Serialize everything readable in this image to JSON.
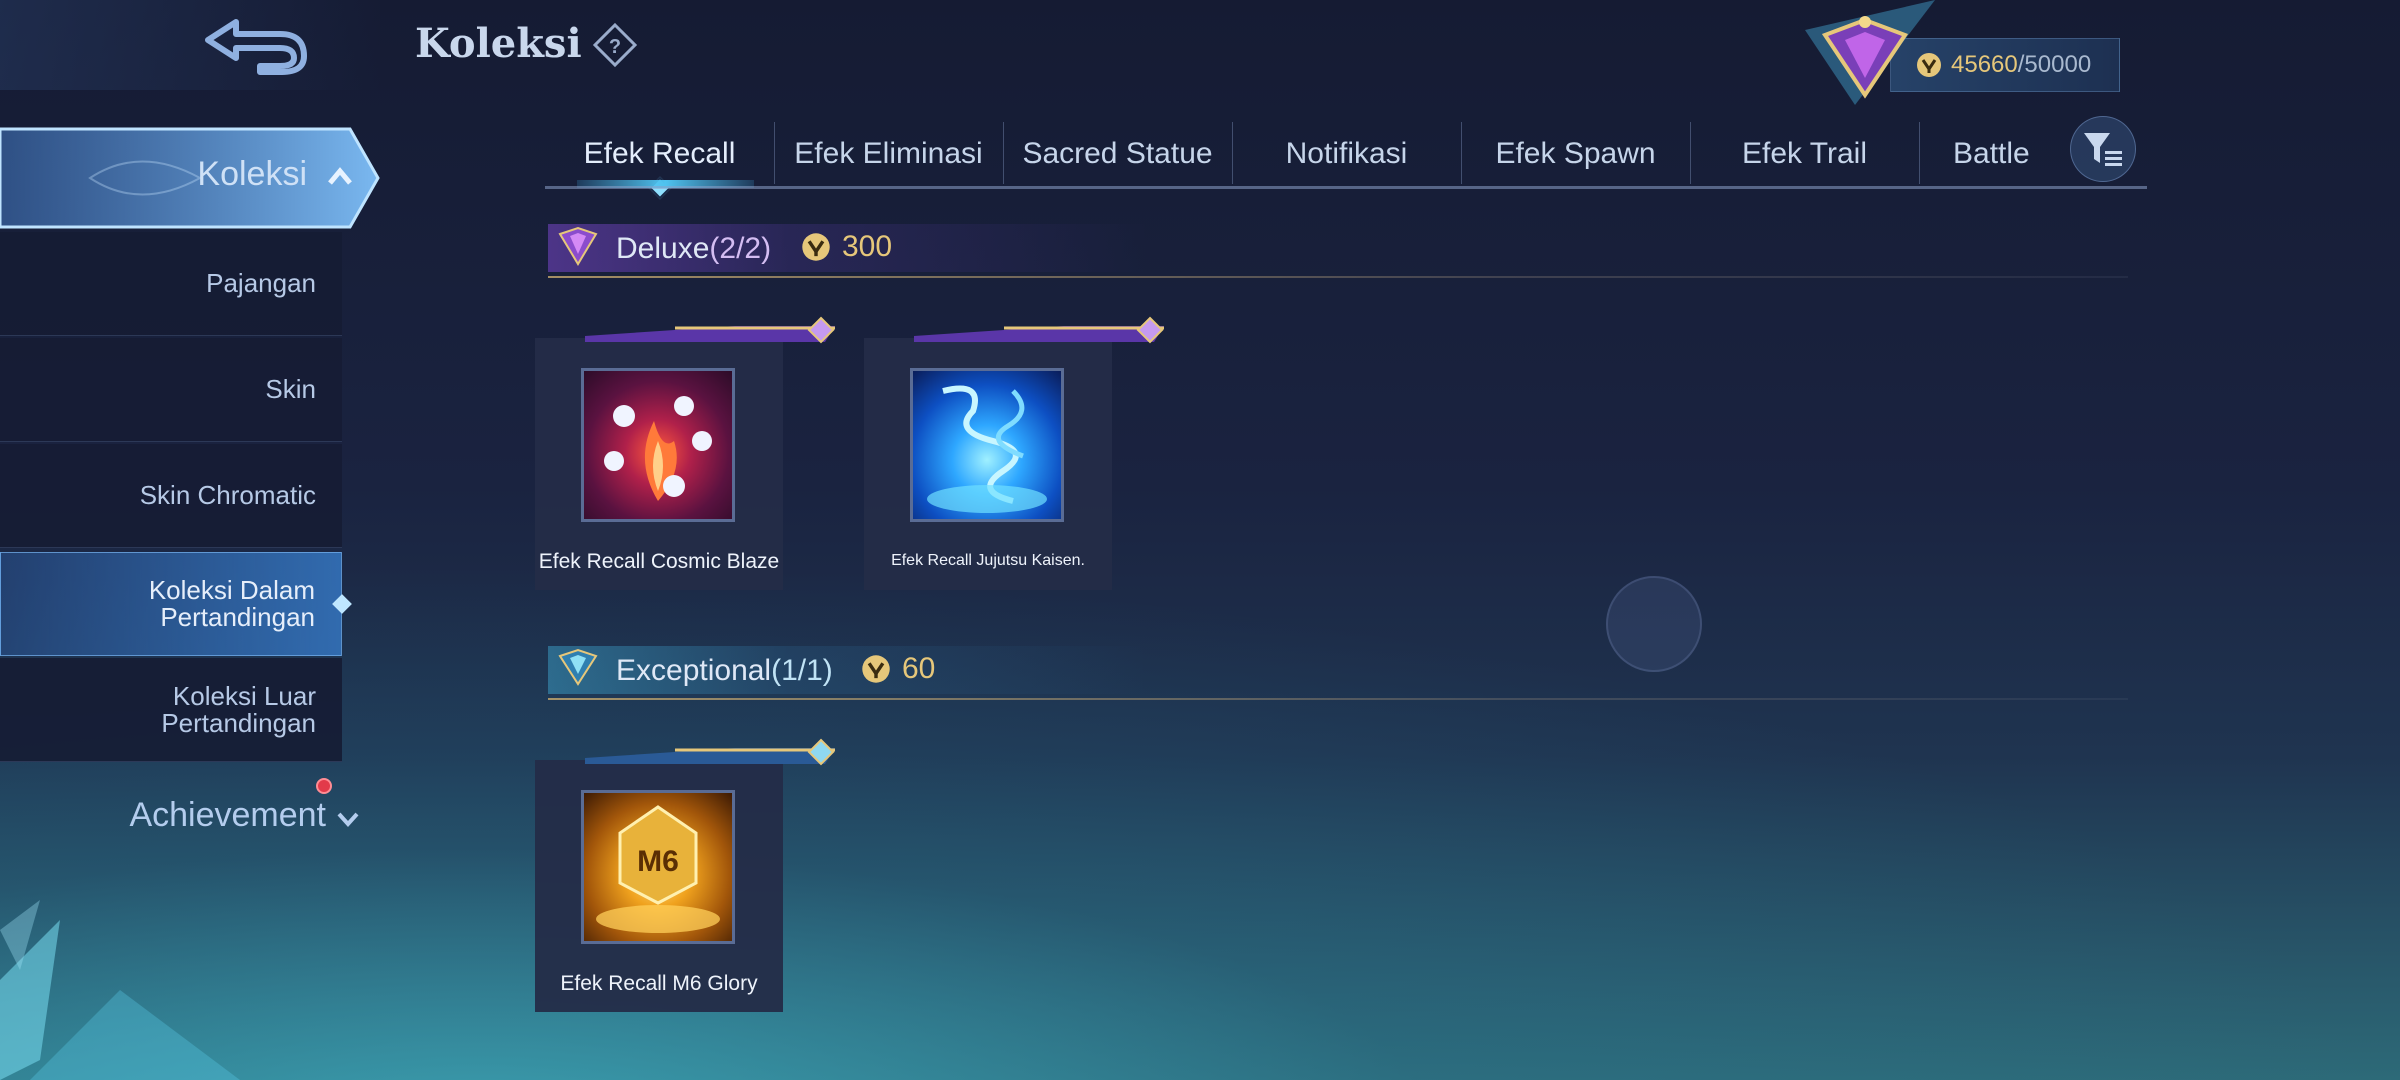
{
  "header": {
    "title": "Koleksi",
    "points_current": "45660",
    "points_separator": "/",
    "points_total": "50000"
  },
  "sidebar": {
    "header_label": "Koleksi",
    "items": [
      {
        "label": "Pajangan",
        "active": false
      },
      {
        "label": "Skin",
        "active": false
      },
      {
        "label": "Skin Chromatic",
        "active": false
      },
      {
        "label": "Koleksi Dalam Pertandingan",
        "active": true
      },
      {
        "label": "Koleksi Luar Pertandingan",
        "active": false
      }
    ],
    "achievement_label": "Achievement"
  },
  "tabs": [
    {
      "label": "Efek Recall",
      "active": true
    },
    {
      "label": "Efek Eliminasi",
      "active": false
    },
    {
      "label": "Sacred Statue",
      "active": false
    },
    {
      "label": "Notifikasi",
      "active": false
    },
    {
      "label": "Efek Spawn",
      "active": false
    },
    {
      "label": "Efek Trail",
      "active": false
    },
    {
      "label": "Battle",
      "active": false
    }
  ],
  "sections": [
    {
      "name": "Deluxe",
      "count": "(2/2)",
      "price": "300",
      "tier_color": "#a86ae0",
      "cards": [
        {
          "label": "Efek Recall Cosmic Blaze"
        },
        {
          "label": "Efek Recall Jujutsu Kaisen."
        }
      ]
    },
    {
      "name": "Exceptional",
      "count": "(1/1)",
      "price": "60",
      "tier_color": "#4fc3e0",
      "cards": [
        {
          "label": "Efek Recall M6 Glory"
        }
      ]
    }
  ],
  "icons": {
    "back": "back-arrow-icon",
    "help": "question-diamond-icon",
    "coin": "coin-icon",
    "filter": "filter-icon",
    "rank": "rank-emblem-icon"
  },
  "colors": {
    "gold": "#e6c77a",
    "accent": "#4fc3f0",
    "notification": "#e23a4a"
  }
}
